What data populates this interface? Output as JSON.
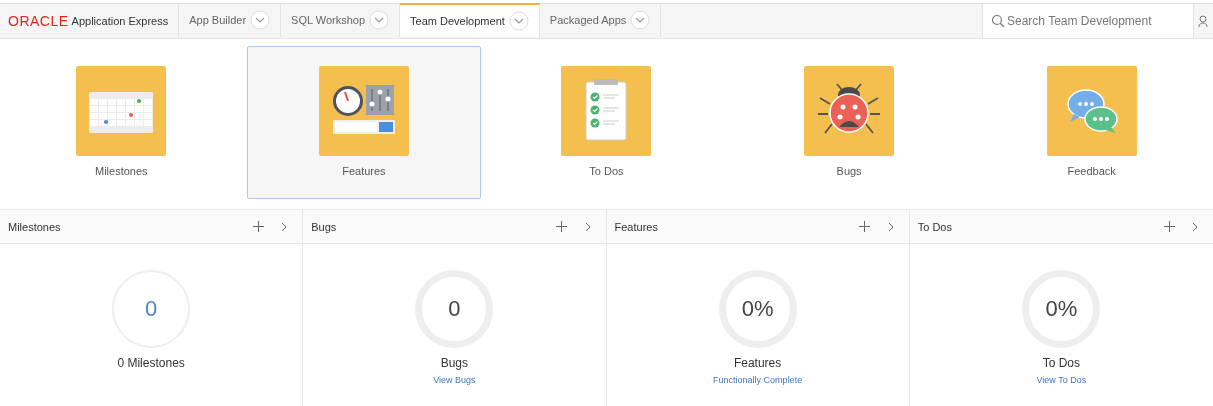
{
  "header": {
    "brand": "ORACLE",
    "product": "Application Express",
    "tabs": [
      {
        "label": "App Builder",
        "selected": false
      },
      {
        "label": "SQL Workshop",
        "selected": false
      },
      {
        "label": "Team Development",
        "selected": true
      },
      {
        "label": "Packaged Apps",
        "selected": false
      }
    ],
    "search": {
      "placeholder": "Search Team Development"
    }
  },
  "tiles": [
    {
      "kind": "calendar",
      "label": "Milestones",
      "selected": false
    },
    {
      "kind": "controls",
      "label": "Features",
      "selected": true
    },
    {
      "kind": "checklist",
      "label": "To Dos",
      "selected": false
    },
    {
      "kind": "bug",
      "label": "Bugs",
      "selected": false
    },
    {
      "kind": "chat",
      "label": "Feedback",
      "selected": false
    }
  ],
  "panels": [
    {
      "title": "Milestones",
      "kind": "count",
      "value": "0",
      "caption": "0 Milestones"
    },
    {
      "title": "Bugs",
      "kind": "ring",
      "value": "0",
      "caption": "Bugs",
      "link": "View Bugs"
    },
    {
      "title": "Features",
      "kind": "ring",
      "value": "0%",
      "caption": "Features",
      "link": "Functionally Complete"
    },
    {
      "title": "To Dos",
      "kind": "ring",
      "value": "0%",
      "caption": "To Dos",
      "link": "View To Dos"
    }
  ]
}
